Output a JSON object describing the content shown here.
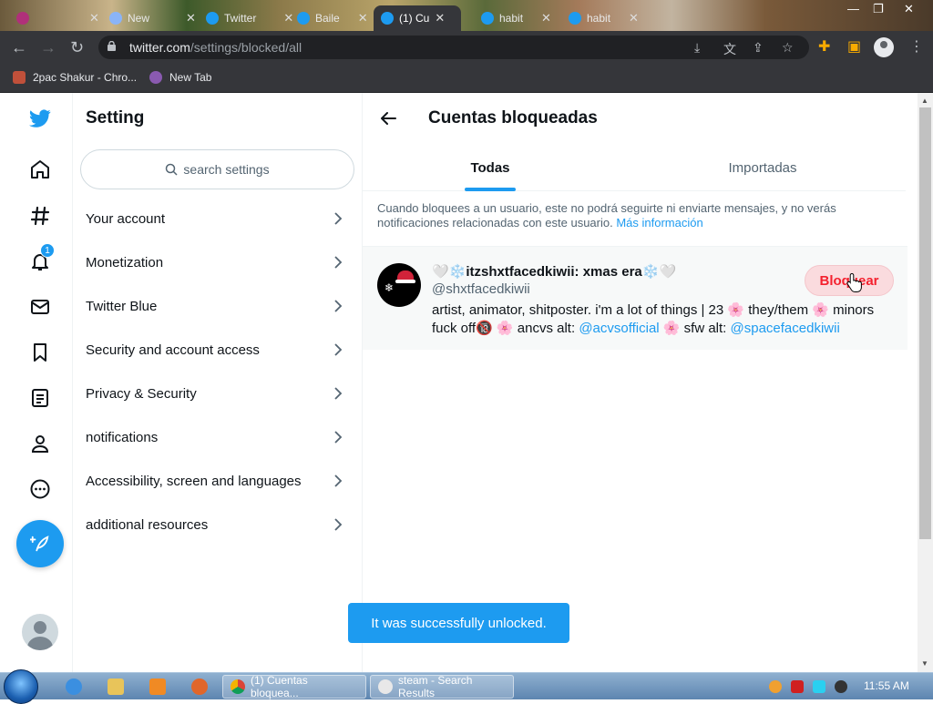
{
  "browser": {
    "tabs": [
      {
        "title": "",
        "active": false
      },
      {
        "title": "New",
        "active": false
      },
      {
        "title": "Twitter",
        "active": false
      },
      {
        "title": "Baile",
        "active": false
      },
      {
        "title": "(1) Cu",
        "active": true
      },
      {
        "title": "habit",
        "active": false
      },
      {
        "title": "habit",
        "active": false
      }
    ],
    "url_host": "twitter.com",
    "url_path": "/settings/blocked/all",
    "bookmarks": [
      "2pac Shakur - Chro...",
      "New Tab"
    ]
  },
  "leftnav": {
    "notification_count": "1",
    "icons": [
      "twitter-logo-icon",
      "home-icon",
      "explore-icon",
      "notifications-icon",
      "messages-icon",
      "bookmarks-icon",
      "lists-icon",
      "profile-icon",
      "more-icon"
    ]
  },
  "settings": {
    "title": "Setting",
    "search_placeholder": "search settings",
    "items": [
      {
        "label": "Your account"
      },
      {
        "label": "Monetization"
      },
      {
        "label": "Twitter Blue"
      },
      {
        "label": "Security and account access"
      },
      {
        "label": "Privacy & Security"
      },
      {
        "label": "notifications"
      },
      {
        "label": "Accessibility, screen and languages"
      },
      {
        "label": "additional resources"
      }
    ]
  },
  "main": {
    "title": "Cuentas bloqueadas",
    "tabs": [
      {
        "label": "Todas",
        "active": true
      },
      {
        "label": "Importadas",
        "active": false
      }
    ],
    "info_text": "Cuando bloquees a un usuario, este no podrá seguirte ni enviarte mensajes, y no verás notificaciones relacionadas con este usuario.",
    "info_link": "Más información",
    "blocked_user": {
      "name": "🤍❄️itzshxtfacedkiwii: xmas era❄️🤍",
      "handle": "@shxtfacedkiwii",
      "bio_part1": "artist, animator, shitposter. i'm a lot of things | 23 🌸 they/them 🌸 minors fuck off🔞 🌸 ancvs alt: ",
      "bio_link1": "@acvsofficial",
      "bio_part2": " 🌸 sfw alt: ",
      "bio_link2": "@spacefacedkiwii",
      "button_label": "Bloquear"
    },
    "toast": "It was successfully unlocked."
  },
  "taskbar": {
    "windows": [
      "(1) Cuentas bloquea...",
      "steam - Search Results"
    ],
    "clock": "11:55 AM"
  },
  "colors": {
    "accent": "#1d9bf0",
    "block_red": "#f4212e",
    "text_primary": "#0f1419",
    "text_secondary": "#536471"
  }
}
